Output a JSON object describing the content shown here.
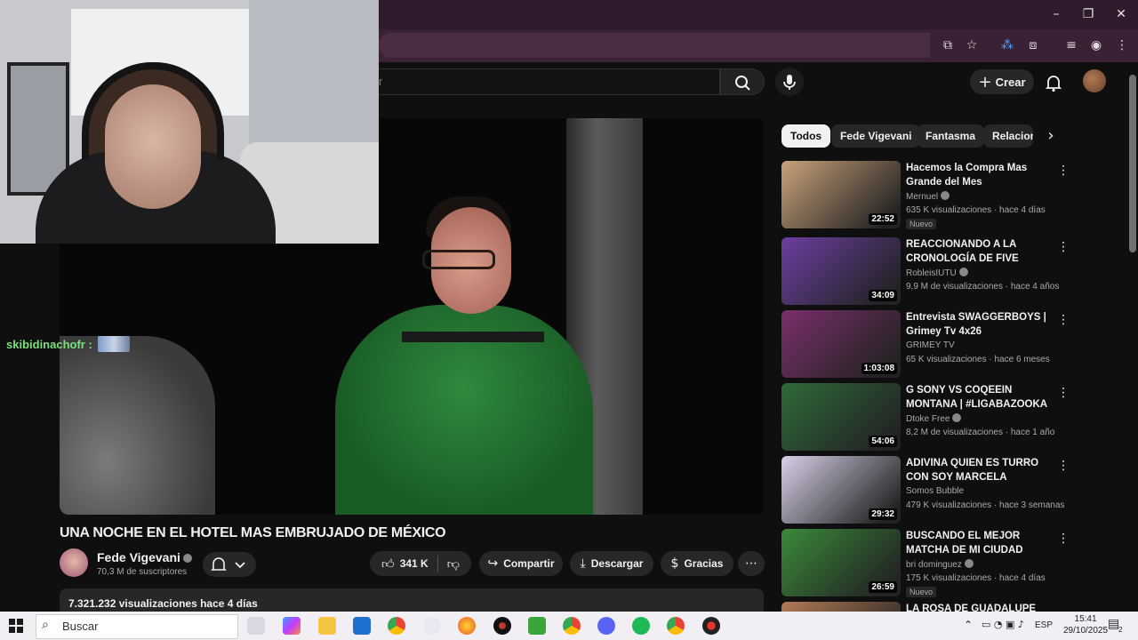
{
  "browser": {
    "window_controls": {
      "minimize": "–",
      "restore": "❐",
      "close": "✕"
    }
  },
  "youtube": {
    "search_placeholder": "r",
    "create_label": "Crear",
    "video": {
      "title": "UNA NOCHE EN EL HOTEL MAS EMBRUJADO DE MÉXICO",
      "channel": "Fede Vigevani",
      "subscribers": "70,3 M de suscriptores",
      "likes": "341 K",
      "share_label": "Compartir",
      "download_label": "Descargar",
      "thanks_label": "Gracias",
      "views_line": "7.321.232 visualizaciones  hace 4 días"
    },
    "chips": [
      "Todos",
      "Fede Vigevani",
      "Fantasma",
      "Relacion"
    ],
    "recommendations": [
      {
        "title": "Hacemos la Compra Mas Grande del Mes",
        "channel": "Mernuel",
        "meta": "635 K visualizaciones · hace 4 días",
        "duration": "22:52",
        "badge": "Nuevo",
        "verified": true
      },
      {
        "title": "REACCIONANDO A LA CRONOLOGÍA DE FIVE NIGHT…",
        "channel": "RobleisIUTU",
        "meta": "9,9 M de visualizaciones · hace 4 años",
        "duration": "34:09",
        "badge": "",
        "verified": true
      },
      {
        "title": "Entrevista SWAGGERBOYS | Grimey Tv 4x26",
        "channel": "GRIMEY TV",
        "meta": "65 K visualizaciones · hace 6 meses",
        "duration": "1:03:08",
        "badge": "",
        "verified": false
      },
      {
        "title": "G SONY VS COQEEIN MONTANA | #LIGABAZOOKA …",
        "channel": "Dtoke Free",
        "meta": "8,2 M de visualizaciones · hace 1 año",
        "duration": "54:06",
        "badge": "",
        "verified": true
      },
      {
        "title": "ADIVINA QUIEN ES TURRO CON SOY MARCELA",
        "channel": "Somos Bubble",
        "meta": "479 K visualizaciones · hace 3 semanas",
        "duration": "29:32",
        "badge": "",
        "verified": false
      },
      {
        "title": "BUSCANDO EL MEJOR MATCHA DE MI CIUDAD",
        "channel": "bri dominguez",
        "meta": "175 K visualizaciones · hace 4 días",
        "duration": "26:59",
        "badge": "Nuevo",
        "verified": true
      },
      {
        "title": "LA ROSA DE GUADALUPE",
        "channel": "",
        "meta": "",
        "duration": "",
        "badge": "",
        "verified": false
      }
    ],
    "thumb_colors": [
      "#c9a27a",
      "#6b3fa0",
      "#7a2f6a",
      "#2f6a3a",
      "#d8d0e8",
      "#3a8a3a",
      "#b07a55"
    ]
  },
  "stream": {
    "chat_user": "skibidinachofr :"
  },
  "taskbar": {
    "search_label": "Buscar",
    "language": "ESP",
    "time": "15:41",
    "date": "29/10/2025",
    "notifications": "2"
  }
}
